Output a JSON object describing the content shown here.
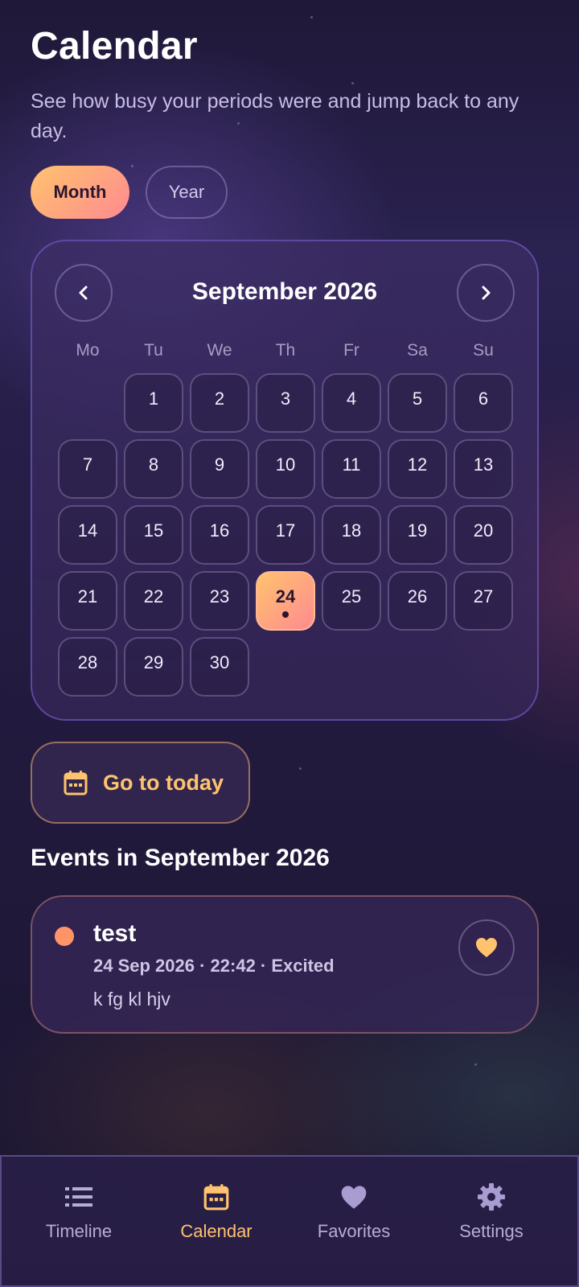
{
  "header": {
    "title": "Calendar",
    "subtitle": "See how busy your periods were and jump back to any day."
  },
  "view_toggle": {
    "options": [
      "Month",
      "Year"
    ],
    "selected": "Month"
  },
  "calendar": {
    "month_label": "September 2026",
    "weekdays": [
      "Mo",
      "Tu",
      "We",
      "Th",
      "Fr",
      "Sa",
      "Su"
    ],
    "days": [
      "1",
      "2",
      "3",
      "4",
      "5",
      "6",
      "7",
      "8",
      "9",
      "10",
      "11",
      "12",
      "13",
      "14",
      "15",
      "16",
      "17",
      "18",
      "19",
      "20",
      "21",
      "22",
      "23",
      "24",
      "25",
      "26",
      "27",
      "28",
      "29",
      "30"
    ],
    "selected_day": "24",
    "days_with_events": [
      "24"
    ]
  },
  "today_button": {
    "label": "Go to today"
  },
  "events_section": {
    "heading": "Events in September 2026",
    "events": [
      {
        "title": "test",
        "meta": "24 Sep 2026 · 22:42 · Excited",
        "note": "k fg kl hjv",
        "color": "#ff9468",
        "favorite": true
      }
    ]
  },
  "bottom_nav": {
    "items": [
      {
        "label": "Timeline",
        "icon": "list-icon"
      },
      {
        "label": "Calendar",
        "icon": "calendar-icon"
      },
      {
        "label": "Favorites",
        "icon": "heart-icon"
      },
      {
        "label": "Settings",
        "icon": "gear-icon"
      }
    ],
    "active": "Calendar"
  },
  "colors": {
    "accent": "#ffc36e",
    "accent_pink": "#ff8a90",
    "event_dot": "#ff9468"
  }
}
